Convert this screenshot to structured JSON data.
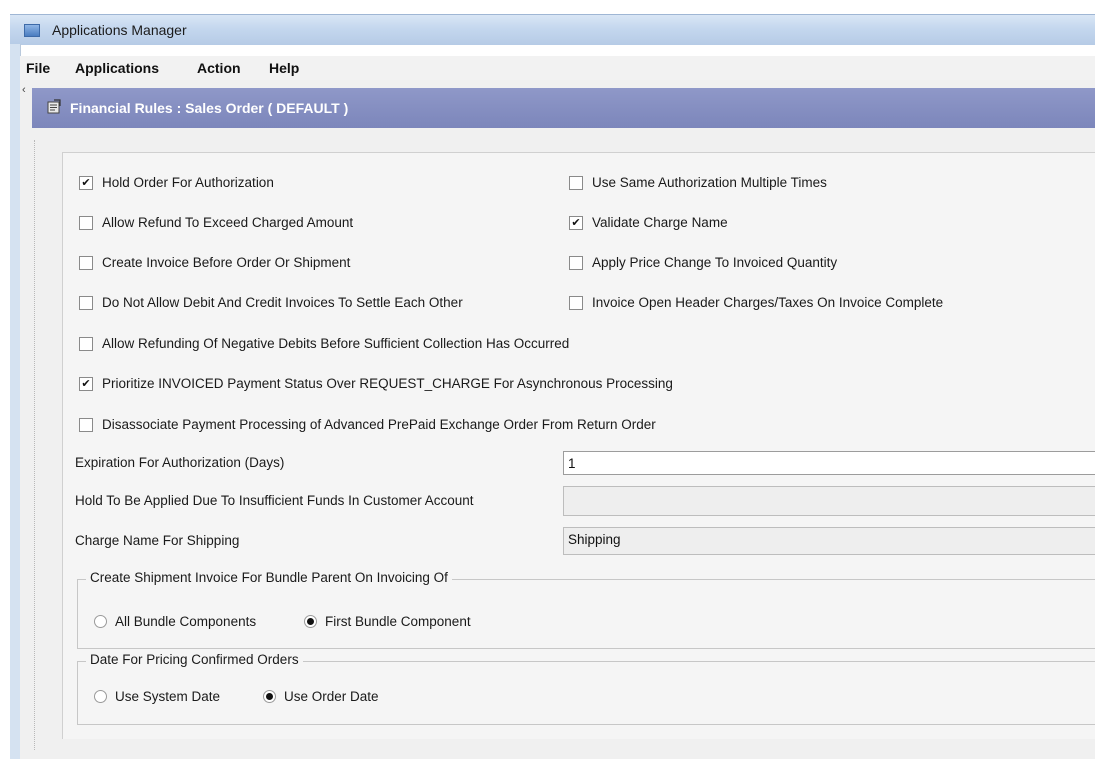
{
  "window": {
    "title": "Applications Manager"
  },
  "menu": [
    "File",
    "Applications",
    "Action",
    "Help"
  ],
  "header": {
    "title": "Financial Rules : Sales Order ( DEFAULT )",
    "icon": "rules-icon"
  },
  "checkboxes": {
    "hold_order": {
      "label": "Hold Order For Authorization",
      "checked": true
    },
    "same_auth": {
      "label": "Use Same Authorization Multiple Times",
      "checked": false
    },
    "refund_exceed": {
      "label": "Allow Refund To Exceed Charged Amount",
      "checked": false
    },
    "validate_charge": {
      "label": "Validate Charge Name",
      "checked": true
    },
    "invoice_before": {
      "label": "Create Invoice Before Order Or Shipment",
      "checked": false
    },
    "price_change": {
      "label": "Apply Price Change To Invoiced Quantity",
      "checked": false
    },
    "no_debit_credit": {
      "label": "Do Not Allow Debit And Credit Invoices To Settle Each Other",
      "checked": false
    },
    "open_header": {
      "label": "Invoice Open Header Charges/Taxes On Invoice Complete",
      "checked": false
    },
    "refund_negative": {
      "label": "Allow Refunding Of Negative Debits Before Sufficient Collection Has Occurred",
      "checked": false
    },
    "prioritize": {
      "label": "Prioritize INVOICED Payment Status Over REQUEST_CHARGE For Asynchronous Processing",
      "checked": true
    },
    "disassociate": {
      "label": "Disassociate Payment Processing of Advanced PrePaid Exchange Order From Return Order",
      "checked": false
    }
  },
  "fields": {
    "expiration": {
      "label": "Expiration For Authorization (Days)",
      "value": "1"
    },
    "hold_funds": {
      "label": "Hold To Be Applied Due To Insufficient Funds In Customer Account",
      "value": ""
    },
    "charge_shipping": {
      "label": "Charge Name For Shipping",
      "value": "Shipping"
    }
  },
  "groups": {
    "bundle": {
      "legend": "Create Shipment Invoice For Bundle Parent On Invoicing Of",
      "options": [
        {
          "label": "All Bundle Components",
          "selected": false
        },
        {
          "label": "First Bundle Component",
          "selected": true
        }
      ]
    },
    "pricing_date": {
      "legend": "Date For Pricing Confirmed Orders",
      "options": [
        {
          "label": "Use System Date",
          "selected": false
        },
        {
          "label": "Use Order Date",
          "selected": true
        }
      ]
    }
  },
  "colors": {
    "header_bg": "#7c86bb",
    "titlebar_bg": "#c4d7ee",
    "panel_bg": "#f0f0f0"
  }
}
